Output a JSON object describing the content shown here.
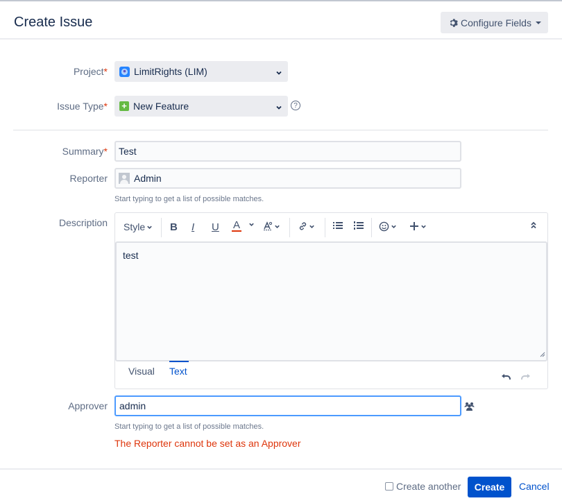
{
  "dialog": {
    "title": "Create Issue",
    "configure_fields_label": "Configure Fields"
  },
  "form": {
    "required_marker": "*",
    "project": {
      "label": "Project",
      "value": "LimitRights (LIM)",
      "icon": "project-avatar-icon"
    },
    "issue_type": {
      "label": "Issue Type",
      "value": "New Feature",
      "icon": "new-feature-icon",
      "help": "?"
    },
    "summary": {
      "label": "Summary",
      "value": "Test"
    },
    "reporter": {
      "label": "Reporter",
      "value": "Admin",
      "hint": "Start typing to get a list of possible matches."
    },
    "description": {
      "label": "Description",
      "toolbar": {
        "style_label": "Style",
        "bold": "B",
        "italic": "I",
        "underline": "U",
        "text_color": "A",
        "text_color_accent": "#de350b"
      },
      "value": "test",
      "tabs": [
        {
          "label": "Visual",
          "active": false
        },
        {
          "label": "Text",
          "active": true
        }
      ]
    },
    "approver": {
      "label": "Approver",
      "value": "admin",
      "hint": "Start typing to get a list of possible matches.",
      "error": "The Reporter cannot be set as an Approver"
    }
  },
  "footer": {
    "create_another_label": "Create another",
    "create_another_checked": false,
    "create_label": "Create",
    "cancel_label": "Cancel"
  },
  "colors": {
    "primary": "#0052cc",
    "error": "#de350b",
    "focus_border": "#4c9aff"
  }
}
